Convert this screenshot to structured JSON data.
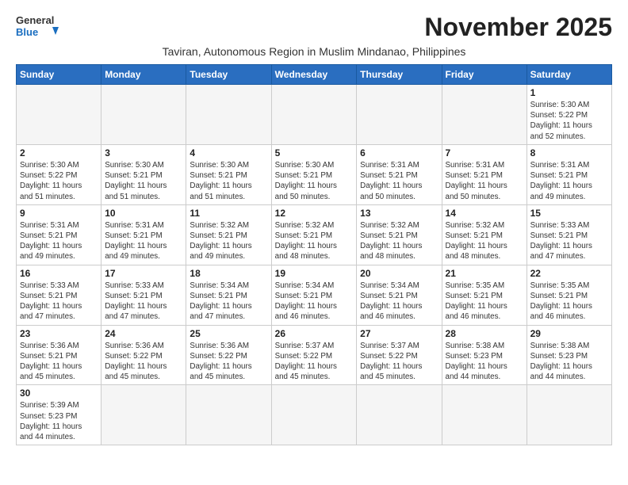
{
  "header": {
    "logo_line1": "General",
    "logo_line2": "Blue",
    "month_title": "November 2025",
    "subtitle": "Taviran, Autonomous Region in Muslim Mindanao, Philippines"
  },
  "weekdays": [
    "Sunday",
    "Monday",
    "Tuesday",
    "Wednesday",
    "Thursday",
    "Friday",
    "Saturday"
  ],
  "weeks": [
    [
      {
        "day": "",
        "info": ""
      },
      {
        "day": "",
        "info": ""
      },
      {
        "day": "",
        "info": ""
      },
      {
        "day": "",
        "info": ""
      },
      {
        "day": "",
        "info": ""
      },
      {
        "day": "",
        "info": ""
      },
      {
        "day": "1",
        "info": "Sunrise: 5:30 AM\nSunset: 5:22 PM\nDaylight: 11 hours\nand 52 minutes."
      }
    ],
    [
      {
        "day": "2",
        "info": "Sunrise: 5:30 AM\nSunset: 5:22 PM\nDaylight: 11 hours\nand 51 minutes."
      },
      {
        "day": "3",
        "info": "Sunrise: 5:30 AM\nSunset: 5:21 PM\nDaylight: 11 hours\nand 51 minutes."
      },
      {
        "day": "4",
        "info": "Sunrise: 5:30 AM\nSunset: 5:21 PM\nDaylight: 11 hours\nand 51 minutes."
      },
      {
        "day": "5",
        "info": "Sunrise: 5:30 AM\nSunset: 5:21 PM\nDaylight: 11 hours\nand 50 minutes."
      },
      {
        "day": "6",
        "info": "Sunrise: 5:31 AM\nSunset: 5:21 PM\nDaylight: 11 hours\nand 50 minutes."
      },
      {
        "day": "7",
        "info": "Sunrise: 5:31 AM\nSunset: 5:21 PM\nDaylight: 11 hours\nand 50 minutes."
      },
      {
        "day": "8",
        "info": "Sunrise: 5:31 AM\nSunset: 5:21 PM\nDaylight: 11 hours\nand 49 minutes."
      }
    ],
    [
      {
        "day": "9",
        "info": "Sunrise: 5:31 AM\nSunset: 5:21 PM\nDaylight: 11 hours\nand 49 minutes."
      },
      {
        "day": "10",
        "info": "Sunrise: 5:31 AM\nSunset: 5:21 PM\nDaylight: 11 hours\nand 49 minutes."
      },
      {
        "day": "11",
        "info": "Sunrise: 5:32 AM\nSunset: 5:21 PM\nDaylight: 11 hours\nand 49 minutes."
      },
      {
        "day": "12",
        "info": "Sunrise: 5:32 AM\nSunset: 5:21 PM\nDaylight: 11 hours\nand 48 minutes."
      },
      {
        "day": "13",
        "info": "Sunrise: 5:32 AM\nSunset: 5:21 PM\nDaylight: 11 hours\nand 48 minutes."
      },
      {
        "day": "14",
        "info": "Sunrise: 5:32 AM\nSunset: 5:21 PM\nDaylight: 11 hours\nand 48 minutes."
      },
      {
        "day": "15",
        "info": "Sunrise: 5:33 AM\nSunset: 5:21 PM\nDaylight: 11 hours\nand 47 minutes."
      }
    ],
    [
      {
        "day": "16",
        "info": "Sunrise: 5:33 AM\nSunset: 5:21 PM\nDaylight: 11 hours\nand 47 minutes."
      },
      {
        "day": "17",
        "info": "Sunrise: 5:33 AM\nSunset: 5:21 PM\nDaylight: 11 hours\nand 47 minutes."
      },
      {
        "day": "18",
        "info": "Sunrise: 5:34 AM\nSunset: 5:21 PM\nDaylight: 11 hours\nand 47 minutes."
      },
      {
        "day": "19",
        "info": "Sunrise: 5:34 AM\nSunset: 5:21 PM\nDaylight: 11 hours\nand 46 minutes."
      },
      {
        "day": "20",
        "info": "Sunrise: 5:34 AM\nSunset: 5:21 PM\nDaylight: 11 hours\nand 46 minutes."
      },
      {
        "day": "21",
        "info": "Sunrise: 5:35 AM\nSunset: 5:21 PM\nDaylight: 11 hours\nand 46 minutes."
      },
      {
        "day": "22",
        "info": "Sunrise: 5:35 AM\nSunset: 5:21 PM\nDaylight: 11 hours\nand 46 minutes."
      }
    ],
    [
      {
        "day": "23",
        "info": "Sunrise: 5:36 AM\nSunset: 5:21 PM\nDaylight: 11 hours\nand 45 minutes."
      },
      {
        "day": "24",
        "info": "Sunrise: 5:36 AM\nSunset: 5:22 PM\nDaylight: 11 hours\nand 45 minutes."
      },
      {
        "day": "25",
        "info": "Sunrise: 5:36 AM\nSunset: 5:22 PM\nDaylight: 11 hours\nand 45 minutes."
      },
      {
        "day": "26",
        "info": "Sunrise: 5:37 AM\nSunset: 5:22 PM\nDaylight: 11 hours\nand 45 minutes."
      },
      {
        "day": "27",
        "info": "Sunrise: 5:37 AM\nSunset: 5:22 PM\nDaylight: 11 hours\nand 45 minutes."
      },
      {
        "day": "28",
        "info": "Sunrise: 5:38 AM\nSunset: 5:23 PM\nDaylight: 11 hours\nand 44 minutes."
      },
      {
        "day": "29",
        "info": "Sunrise: 5:38 AM\nSunset: 5:23 PM\nDaylight: 11 hours\nand 44 minutes."
      }
    ],
    [
      {
        "day": "30",
        "info": "Sunrise: 5:39 AM\nSunset: 5:23 PM\nDaylight: 11 hours\nand 44 minutes."
      },
      {
        "day": "",
        "info": ""
      },
      {
        "day": "",
        "info": ""
      },
      {
        "day": "",
        "info": ""
      },
      {
        "day": "",
        "info": ""
      },
      {
        "day": "",
        "info": ""
      },
      {
        "day": "",
        "info": ""
      }
    ]
  ]
}
